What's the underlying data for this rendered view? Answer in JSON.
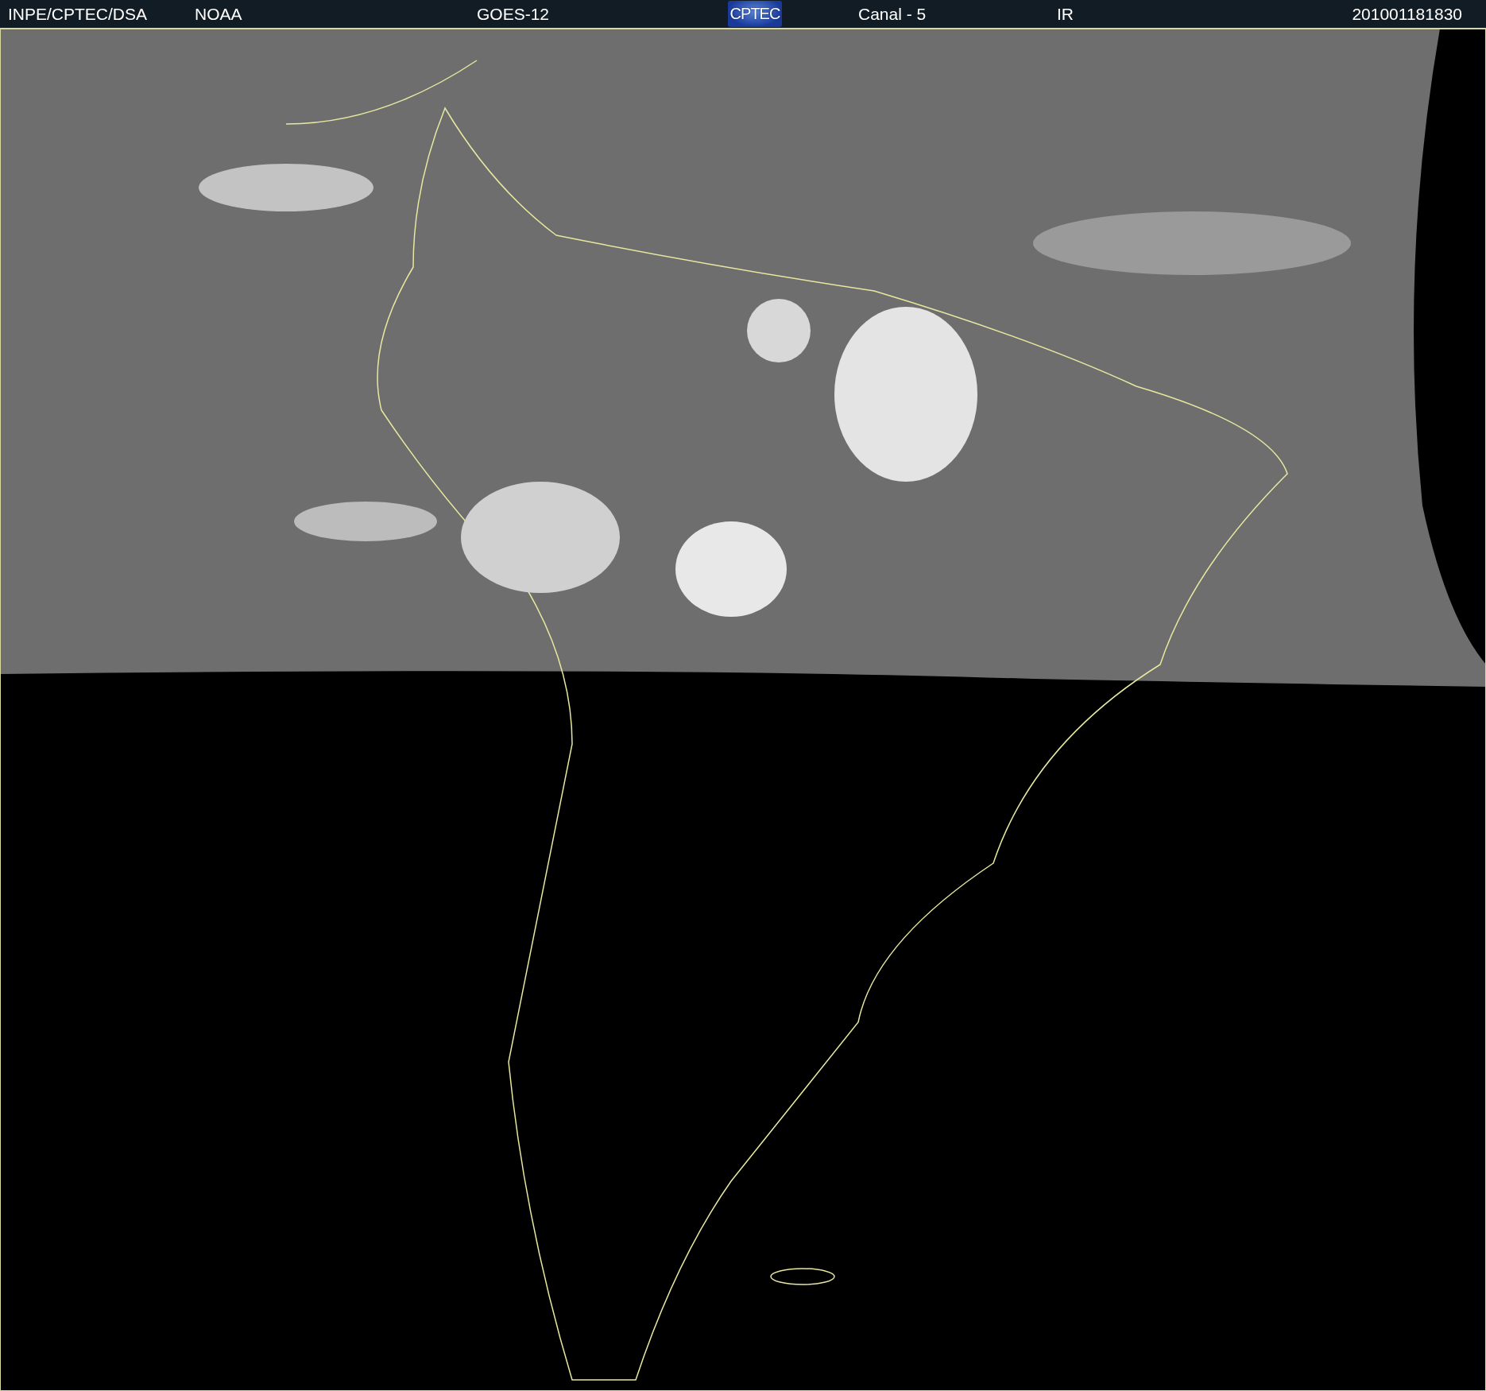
{
  "header": {
    "items": [
      {
        "kind": "text",
        "text": "INPE/CPTEC/DSA"
      },
      {
        "kind": "text",
        "text": "NOAA"
      },
      {
        "kind": "text",
        "text": "GOES-12"
      },
      {
        "kind": "logo",
        "text": "CPTEC"
      },
      {
        "kind": "text",
        "text": "Canal - 5"
      },
      {
        "kind": "text",
        "text": "IR"
      },
      {
        "kind": "text",
        "text": "201001181830"
      }
    ]
  }
}
